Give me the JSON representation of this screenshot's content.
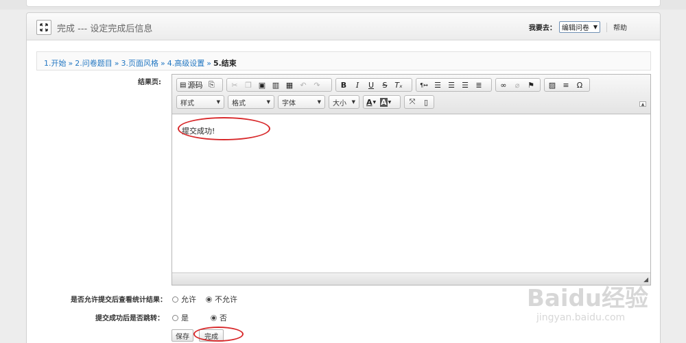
{
  "header": {
    "title": "完成 --- 设定完成后信息",
    "goto_label": "我要去：",
    "goto_value": "编辑问卷",
    "help": "帮助"
  },
  "breadcrumb": {
    "steps": [
      "1.开始",
      "2.问卷题目",
      "3.页面风格",
      "4.高级设置"
    ],
    "current": "5.结束",
    "separator": "»"
  },
  "editor": {
    "label": "结果页:",
    "source_btn": "源码",
    "combos": [
      "样式",
      "格式",
      "字体",
      "大小"
    ],
    "content": "提交成功!"
  },
  "options": {
    "stats_label": "是否允许提交后查看统计结果：",
    "stats_choices": [
      "允许",
      "不允许"
    ],
    "stats_selected": 1,
    "jump_label": "提交成功后是否跳转：",
    "jump_choices": [
      "是",
      "否"
    ],
    "jump_selected": 1
  },
  "actions": {
    "save": "保存",
    "finish": "完成"
  },
  "watermark": {
    "brand": "Baidu经验",
    "url": "jingyan.baidu.com"
  },
  "colors": {
    "link": "#2277c2",
    "highlight": "#d8292b"
  }
}
